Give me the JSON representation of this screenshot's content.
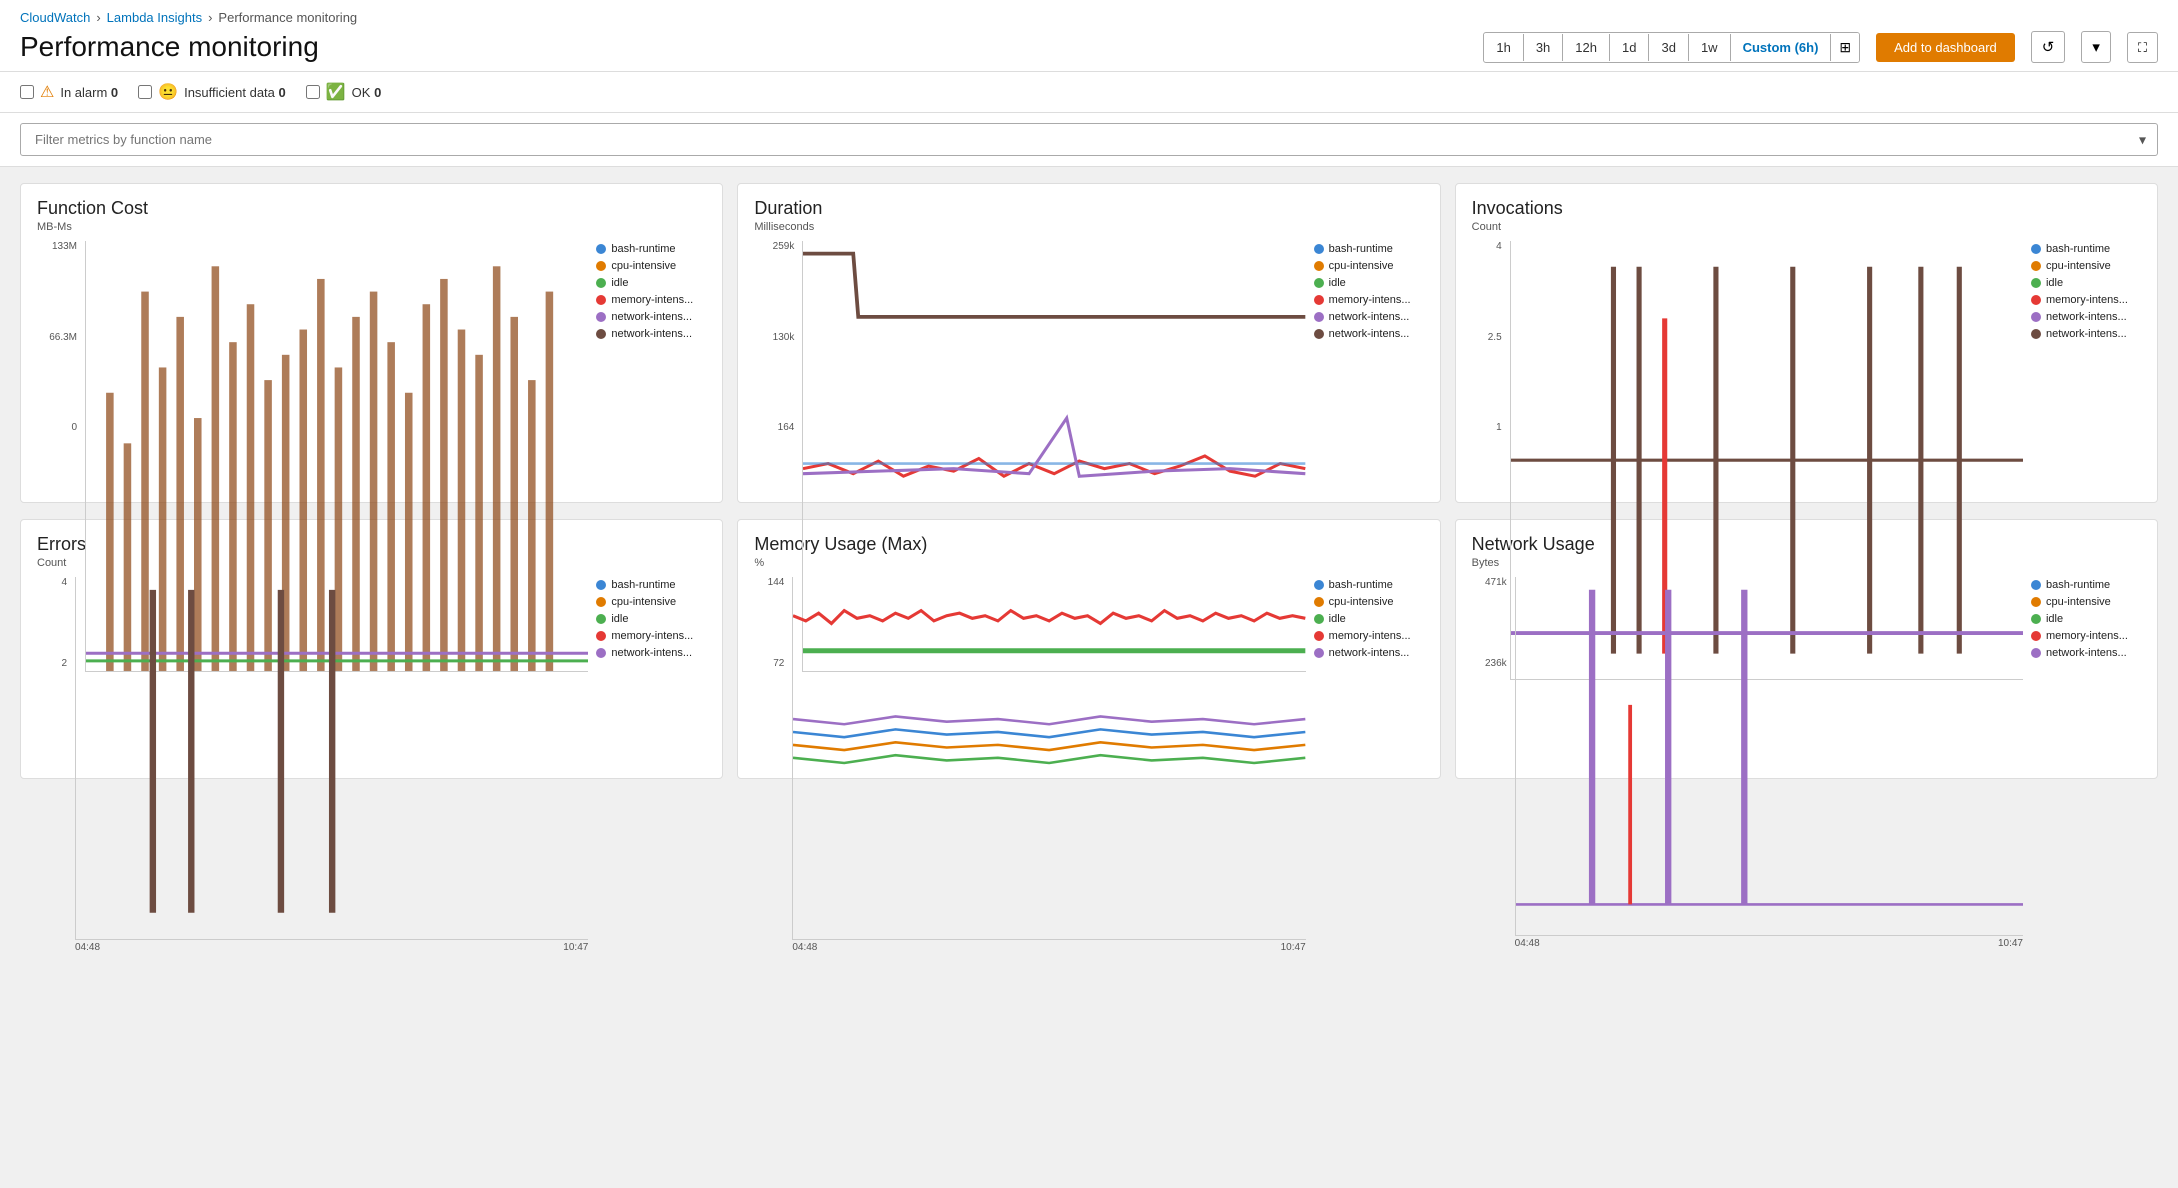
{
  "breadcrumb": {
    "cloudwatch": "CloudWatch",
    "lambda_insights": "Lambda Insights",
    "current": "Performance monitoring"
  },
  "page": {
    "title": "Performance monitoring"
  },
  "time_buttons": [
    {
      "label": "1h",
      "active": false
    },
    {
      "label": "3h",
      "active": false
    },
    {
      "label": "12h",
      "active": false
    },
    {
      "label": "1d",
      "active": false
    },
    {
      "label": "3d",
      "active": false
    },
    {
      "label": "1w",
      "active": false
    },
    {
      "label": "Custom (6h)",
      "active": true
    }
  ],
  "toolbar": {
    "add_dashboard": "Add to dashboard",
    "refresh_icon": "↺",
    "dropdown_icon": "▾",
    "fullscreen_icon": "⛶"
  },
  "alarms": {
    "in_alarm": {
      "label": "In alarm",
      "count": "0"
    },
    "insufficient": {
      "label": "Insufficient data",
      "count": "0"
    },
    "ok": {
      "label": "OK",
      "count": "0"
    }
  },
  "filter": {
    "placeholder": "Filter metrics by function name"
  },
  "charts": [
    {
      "id": "function-cost",
      "title": "Function Cost",
      "subtitle": "MB-Ms",
      "y_labels": [
        "133M",
        "66.3M",
        "0"
      ],
      "x_labels": [
        "04:48",
        "10:47"
      ]
    },
    {
      "id": "duration",
      "title": "Duration",
      "subtitle": "Milliseconds",
      "y_labels": [
        "259k",
        "130k",
        "164"
      ],
      "x_labels": [
        "04:48",
        "10:47"
      ]
    },
    {
      "id": "invocations",
      "title": "Invocations",
      "subtitle": "Count",
      "y_labels": [
        "4",
        "2.5",
        "1"
      ],
      "x_labels": [
        "04:48",
        "10:47"
      ]
    },
    {
      "id": "errors",
      "title": "Errors",
      "subtitle": "Count",
      "y_labels": [
        "4",
        "2",
        ""
      ],
      "x_labels": [
        "04:48",
        "10:47"
      ]
    },
    {
      "id": "memory-usage",
      "title": "Memory Usage (Max)",
      "subtitle": "%",
      "y_labels": [
        "144",
        "72",
        ""
      ],
      "x_labels": [
        "04:48",
        "10:47"
      ]
    },
    {
      "id": "network-usage",
      "title": "Network Usage",
      "subtitle": "Bytes",
      "y_labels": [
        "471k",
        "236k",
        ""
      ],
      "x_labels": [
        "04:48",
        "10:47"
      ]
    }
  ],
  "legend": {
    "items": [
      {
        "label": "bash-runtime",
        "color": "#3b86d4"
      },
      {
        "label": "cpu-intensive",
        "color": "#e07b00"
      },
      {
        "label": "idle",
        "color": "#4caf50"
      },
      {
        "label": "memory-intens...",
        "color": "#e53935"
      },
      {
        "label": "network-intens...",
        "color": "#9c6fc4"
      },
      {
        "label": "network-intens...",
        "color": "#6d4c41"
      }
    ]
  }
}
